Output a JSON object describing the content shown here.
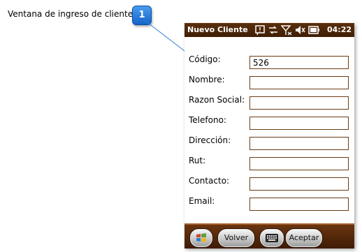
{
  "callout": {
    "text": "Ventana de ingreso de cliente",
    "badge_number": "1"
  },
  "window": {
    "title": "Nuevo Cliente",
    "time": "04:22",
    "status_icons": [
      "notification-icon",
      "connectivity-icon",
      "no-signal-icon",
      "volume-muted-icon",
      "battery-icon"
    ]
  },
  "form": {
    "fields": [
      {
        "label": "Código:",
        "value": "526"
      },
      {
        "label": "Nombre:",
        "value": ""
      },
      {
        "label": "Razon Social:",
        "value": ""
      },
      {
        "label": "Telefono:",
        "value": ""
      },
      {
        "label": "Dirección:",
        "value": ""
      },
      {
        "label": "Rut:",
        "value": ""
      },
      {
        "label": "Contacto:",
        "value": ""
      },
      {
        "label": "Email:",
        "value": ""
      }
    ]
  },
  "softkeys": {
    "left": "Volver",
    "right": "Aceptar",
    "start_icon": "windows-start-icon",
    "keyboard_icon": "keyboard-icon"
  },
  "colors": {
    "titlebar": "#4a250a",
    "field_border": "#6b3a12",
    "badge": "#1e78dc"
  }
}
